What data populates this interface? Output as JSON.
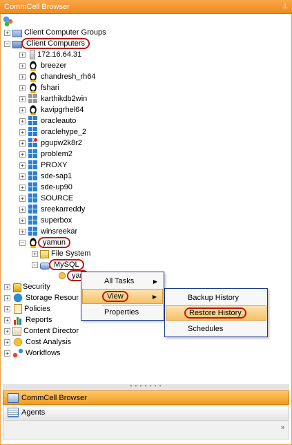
{
  "panel": {
    "title": "CommCell Browser",
    "pin_icon": "pin-icon"
  },
  "tree": {
    "root_label": "",
    "items": [
      {
        "label": "Client Computer Groups",
        "icon": "group-icon"
      },
      {
        "label": "Client Computers",
        "icon": "computers-icon"
      },
      {
        "label": "172.16.64.31",
        "icon": "server-icon"
      },
      {
        "label": "breezer",
        "icon": "linux-icon"
      },
      {
        "label": "chandresh_rh64",
        "icon": "linux-icon"
      },
      {
        "label": "fshari",
        "icon": "linux-icon"
      },
      {
        "label": "karthikdb2win",
        "icon": "windows-gray-icon"
      },
      {
        "label": "kavipgrhel64",
        "icon": "linux-icon"
      },
      {
        "label": "oracleauto",
        "icon": "windows-icon"
      },
      {
        "label": "oraclehype_2",
        "icon": "windows-icon"
      },
      {
        "label": "pgupw2k8r2",
        "icon": "windows-icon"
      },
      {
        "label": "problem2",
        "icon": "windows-icon"
      },
      {
        "label": "PROXY",
        "icon": "windows-icon"
      },
      {
        "label": "sde-sap1",
        "icon": "windows-icon"
      },
      {
        "label": "sde-up90",
        "icon": "windows-icon"
      },
      {
        "label": "SOURCE",
        "icon": "windows-icon"
      },
      {
        "label": "sreekarreddy",
        "icon": "windows-icon"
      },
      {
        "label": "superbox",
        "icon": "windows-icon"
      },
      {
        "label": "winsreekar",
        "icon": "windows-icon"
      },
      {
        "label": "yamun",
        "icon": "linux-icon"
      },
      {
        "label": "File System",
        "icon": "filesystem-icon"
      },
      {
        "label": "MySQL",
        "icon": "mysql-icon"
      },
      {
        "label": "yan",
        "icon": "instance-icon"
      },
      {
        "label": "Security",
        "icon": "security-icon"
      },
      {
        "label": "Storage Resour",
        "icon": "storage-icon"
      },
      {
        "label": "Policies",
        "icon": "policies-icon"
      },
      {
        "label": "Reports",
        "icon": "reports-icon"
      },
      {
        "label": "Content Director",
        "icon": "content-icon"
      },
      {
        "label": "Cost Analysis",
        "icon": "cost-icon"
      },
      {
        "label": "Workflows",
        "icon": "workflow-icon"
      }
    ]
  },
  "context_menu": {
    "items": [
      "All Tasks",
      "View",
      "Properties"
    ]
  },
  "view_submenu": {
    "items": [
      "Backup History",
      "Restore History",
      "Schedules"
    ]
  },
  "bottom_nav": {
    "active": "CommCell Browser",
    "secondary": "Agents",
    "overflow": "»"
  },
  "colors": {
    "accent_orange": "#f29b21",
    "highlight_red": "#c01515",
    "menu_border": "#1b3a8c"
  }
}
